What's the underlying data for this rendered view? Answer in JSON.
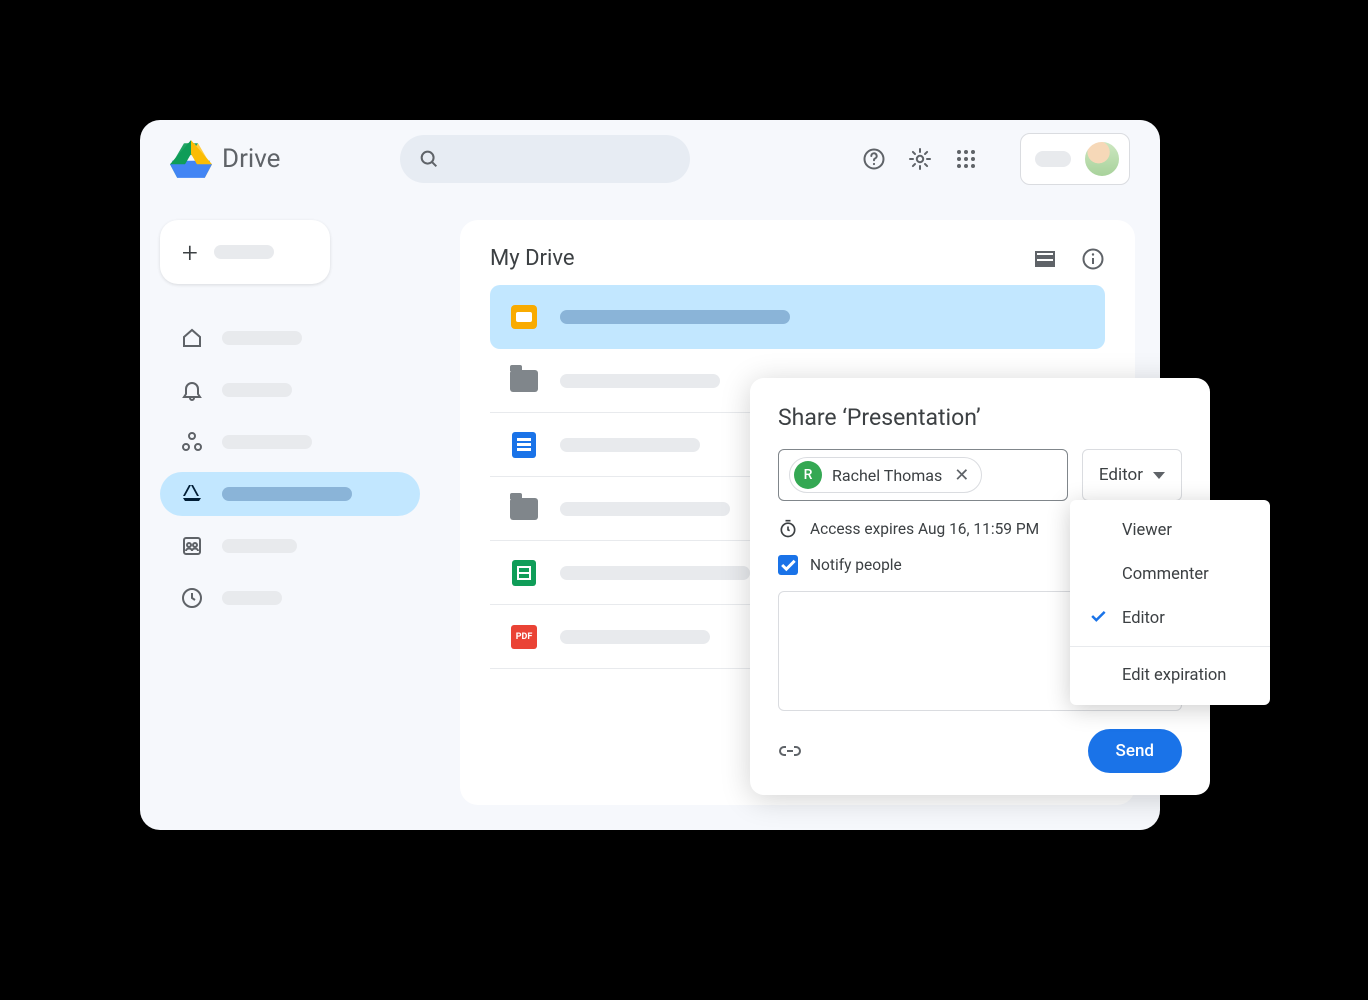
{
  "app": {
    "title": "Drive"
  },
  "main": {
    "heading": "My Drive"
  },
  "files": {
    "pdf_label": "PDF"
  },
  "share": {
    "title": "Share ‘Presentation’",
    "person_initial": "R",
    "person_name": "Rachel Thomas",
    "role_button": "Editor",
    "expires": "Access expires Aug 16, 11:59 PM",
    "notify": "Notify people",
    "send": "Send"
  },
  "role_menu": {
    "viewer": "Viewer",
    "commenter": "Commenter",
    "editor": "Editor",
    "edit_expiration": "Edit expiration"
  }
}
